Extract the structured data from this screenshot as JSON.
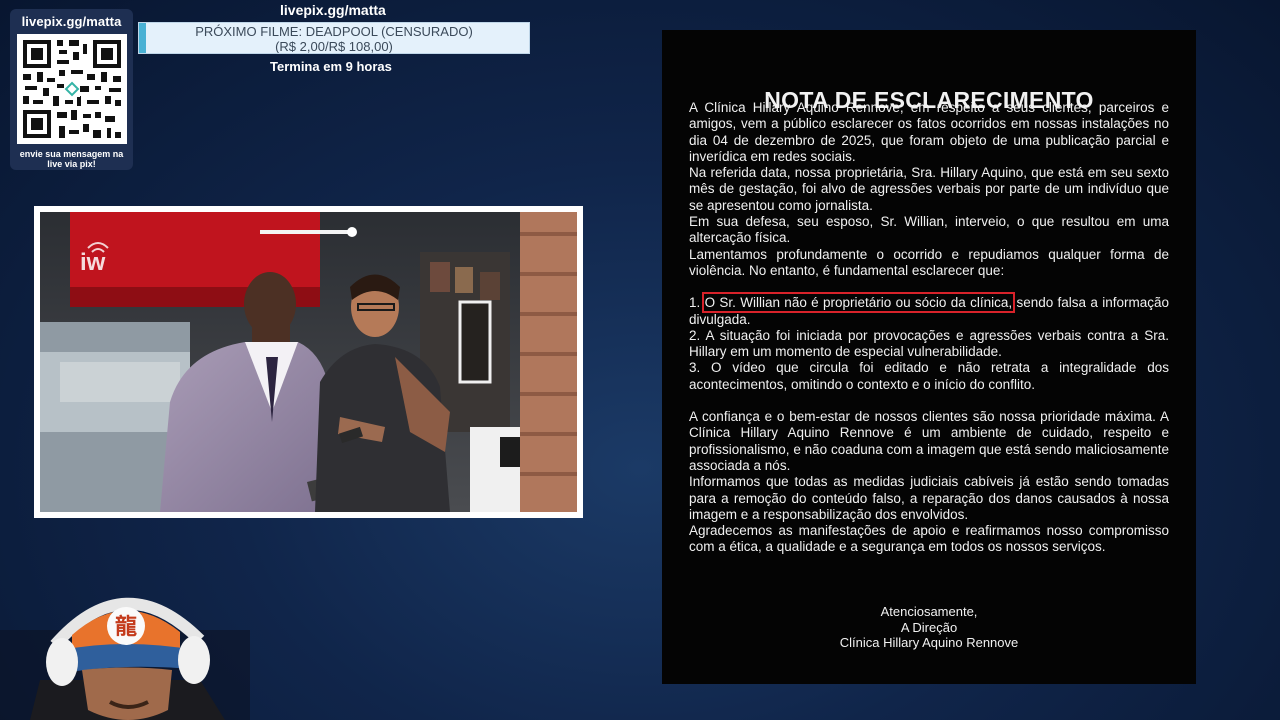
{
  "qr_panel": {
    "url": "livepix.gg/matta",
    "caption": "envie sua mensagem na live via pix!"
  },
  "goal": {
    "link": "livepix.gg/matta",
    "line1": "PRÓXIMO FILME: DEADPOOL (CENSURADO)",
    "line2": "(R$ 2,00/R$ 108,00)",
    "raised": 2.0,
    "target": 108.0,
    "timer": "Termina em 9 horas",
    "fill_color": "#49b1d4",
    "bar_color": "#e4f1fb"
  },
  "video": {
    "store_sign": "iw"
  },
  "note": {
    "title": "NOTA DE ESCLARECIMENTO",
    "intro": "A Clínica Hillary Aquino Rennove, em respeito a seus clientes, parceiros e amigos, vem a público esclarecer os fatos ocorridos em nossas instalações no dia 04 de dezembro de 2025, que foram objeto de uma publicação parcial e inverídica em redes sociais.",
    "p2": "Na referida data, nossa proprietária, Sra. Hillary Aquino, que está em seu sexto mês de gestação, foi alvo de agressões verbais por parte de um indivíduo que se apresentou como jornalista.",
    "p3": "Em sua defesa, seu esposo, Sr. Willian, interveio, o que resultou em uma altercação física.",
    "p4": "Lamentamos profundamente o ocorrido e repudiamos qualquer forma de violência. No entanto, é fundamental esclarecer que:",
    "item1_num": "1.",
    "item1_highlight": "O Sr. Willian não é proprietário ou sócio da clínica,",
    "item1_rest": "sendo falsa a informação divulgada.",
    "item2": "2. A situação foi iniciada por provocações e agressões verbais contra a Sra. Hillary em um momento de especial vulnerabilidade.",
    "item3": "3. O vídeo que circula foi editado e não retrata a integralidade dos acontecimentos, omitindo o contexto e o início do conflito.",
    "p5": "A confiança e o bem-estar de nossos clientes são nossa prioridade máxima. A Clínica Hillary Aquino Rennove é um ambiente de cuidado, respeito e profissionalismo, e não coaduna com a imagem que está sendo maliciosamente associada a nós.",
    "p6": "Informamos que todas as medidas judiciais cabíveis já estão sendo tomadas para a remoção do conteúdo falso, a reparação dos danos causados à nossa imagem e a responsabilização dos envolvidos.",
    "p7": "Agradecemos as manifestações de apoio e reafirmamos nosso compromisso com a ética, a qualidade e a segurança em todos os nossos serviços.",
    "sign1": "Atenciosamente,",
    "sign2": "A Direção",
    "sign3": "Clínica Hillary Aquino Rennove",
    "highlight_color": "#d8222a"
  },
  "webcam": {
    "cap_symbol": "龍"
  }
}
